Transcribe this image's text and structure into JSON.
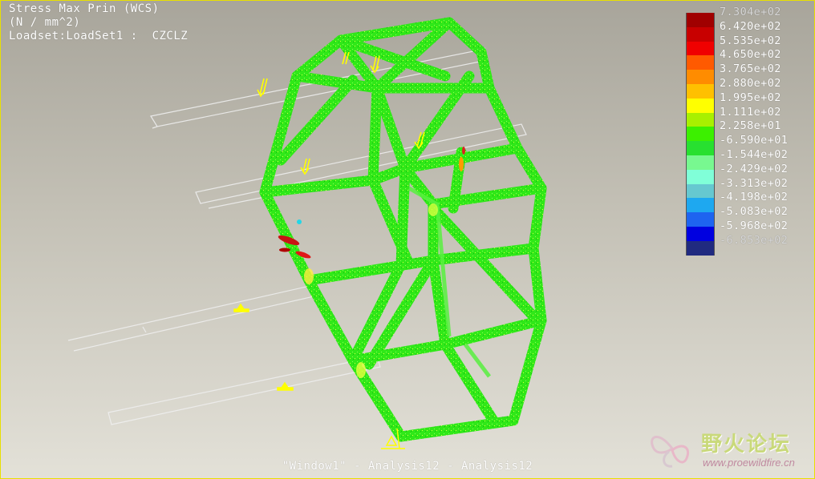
{
  "header": {
    "line1": "Stress Max Prin (WCS)",
    "line2": "(N / mm^2)",
    "line3": "Loadset:LoadSet1 :  CZCLZ"
  },
  "footer": {
    "window_title": "\"Window1\" - Analysis12 - Analysis12"
  },
  "legend": {
    "labels": [
      "7.304e+02",
      "6.420e+02",
      "5.535e+02",
      "4.650e+02",
      "3.765e+02",
      "2.880e+02",
      "1.995e+02",
      "1.111e+02",
      "2.258e+01",
      "-6.590e+01",
      "-1.544e+02",
      "-2.429e+02",
      "-3.313e+02",
      "-4.198e+02",
      "-5.083e+02",
      "-5.968e+02",
      "-6.853e+02"
    ],
    "colors": [
      "#a00000",
      "#c80000",
      "#f00000",
      "#ff5a00",
      "#ff8c00",
      "#ffc000",
      "#ffff00",
      "#a8f000",
      "#3cf000",
      "#28e030",
      "#78f890",
      "#80ffd8",
      "#66c8d0",
      "#1ea8f0",
      "#1e64f0",
      "#0000e0",
      "#202a80"
    ]
  },
  "watermark": {
    "title": "野火论坛",
    "url": "www.proewildfire.cn"
  },
  "colors": {
    "model_green": "#33ee22",
    "wireframe": "#e6e6e6",
    "load_arrow": "#ffff00",
    "constraint": "#ffff00",
    "frame_border": "#e8e000"
  }
}
